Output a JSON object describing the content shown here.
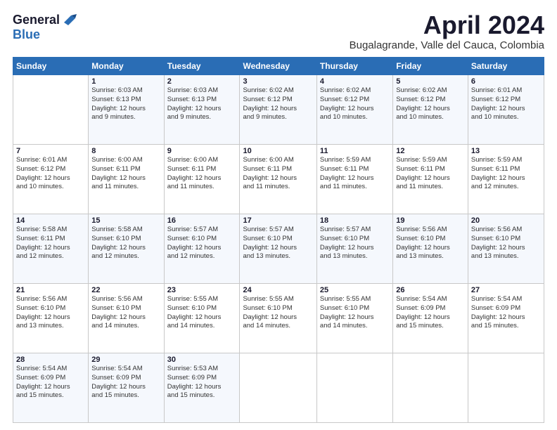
{
  "header": {
    "logo_line1": "General",
    "logo_line2": "Blue",
    "month_title": "April 2024",
    "location": "Bugalagrande, Valle del Cauca, Colombia"
  },
  "weekdays": [
    "Sunday",
    "Monday",
    "Tuesday",
    "Wednesday",
    "Thursday",
    "Friday",
    "Saturday"
  ],
  "weeks": [
    [
      {
        "day": "",
        "info": ""
      },
      {
        "day": "1",
        "info": "Sunrise: 6:03 AM\nSunset: 6:13 PM\nDaylight: 12 hours\nand 9 minutes."
      },
      {
        "day": "2",
        "info": "Sunrise: 6:03 AM\nSunset: 6:13 PM\nDaylight: 12 hours\nand 9 minutes."
      },
      {
        "day": "3",
        "info": "Sunrise: 6:02 AM\nSunset: 6:12 PM\nDaylight: 12 hours\nand 9 minutes."
      },
      {
        "day": "4",
        "info": "Sunrise: 6:02 AM\nSunset: 6:12 PM\nDaylight: 12 hours\nand 10 minutes."
      },
      {
        "day": "5",
        "info": "Sunrise: 6:02 AM\nSunset: 6:12 PM\nDaylight: 12 hours\nand 10 minutes."
      },
      {
        "day": "6",
        "info": "Sunrise: 6:01 AM\nSunset: 6:12 PM\nDaylight: 12 hours\nand 10 minutes."
      }
    ],
    [
      {
        "day": "7",
        "info": "Sunrise: 6:01 AM\nSunset: 6:12 PM\nDaylight: 12 hours\nand 10 minutes."
      },
      {
        "day": "8",
        "info": "Sunrise: 6:00 AM\nSunset: 6:11 PM\nDaylight: 12 hours\nand 11 minutes."
      },
      {
        "day": "9",
        "info": "Sunrise: 6:00 AM\nSunset: 6:11 PM\nDaylight: 12 hours\nand 11 minutes."
      },
      {
        "day": "10",
        "info": "Sunrise: 6:00 AM\nSunset: 6:11 PM\nDaylight: 12 hours\nand 11 minutes."
      },
      {
        "day": "11",
        "info": "Sunrise: 5:59 AM\nSunset: 6:11 PM\nDaylight: 12 hours\nand 11 minutes."
      },
      {
        "day": "12",
        "info": "Sunrise: 5:59 AM\nSunset: 6:11 PM\nDaylight: 12 hours\nand 11 minutes."
      },
      {
        "day": "13",
        "info": "Sunrise: 5:59 AM\nSunset: 6:11 PM\nDaylight: 12 hours\nand 12 minutes."
      }
    ],
    [
      {
        "day": "14",
        "info": "Sunrise: 5:58 AM\nSunset: 6:11 PM\nDaylight: 12 hours\nand 12 minutes."
      },
      {
        "day": "15",
        "info": "Sunrise: 5:58 AM\nSunset: 6:10 PM\nDaylight: 12 hours\nand 12 minutes."
      },
      {
        "day": "16",
        "info": "Sunrise: 5:57 AM\nSunset: 6:10 PM\nDaylight: 12 hours\nand 12 minutes."
      },
      {
        "day": "17",
        "info": "Sunrise: 5:57 AM\nSunset: 6:10 PM\nDaylight: 12 hours\nand 13 minutes."
      },
      {
        "day": "18",
        "info": "Sunrise: 5:57 AM\nSunset: 6:10 PM\nDaylight: 12 hours\nand 13 minutes."
      },
      {
        "day": "19",
        "info": "Sunrise: 5:56 AM\nSunset: 6:10 PM\nDaylight: 12 hours\nand 13 minutes."
      },
      {
        "day": "20",
        "info": "Sunrise: 5:56 AM\nSunset: 6:10 PM\nDaylight: 12 hours\nand 13 minutes."
      }
    ],
    [
      {
        "day": "21",
        "info": "Sunrise: 5:56 AM\nSunset: 6:10 PM\nDaylight: 12 hours\nand 13 minutes."
      },
      {
        "day": "22",
        "info": "Sunrise: 5:56 AM\nSunset: 6:10 PM\nDaylight: 12 hours\nand 14 minutes."
      },
      {
        "day": "23",
        "info": "Sunrise: 5:55 AM\nSunset: 6:10 PM\nDaylight: 12 hours\nand 14 minutes."
      },
      {
        "day": "24",
        "info": "Sunrise: 5:55 AM\nSunset: 6:10 PM\nDaylight: 12 hours\nand 14 minutes."
      },
      {
        "day": "25",
        "info": "Sunrise: 5:55 AM\nSunset: 6:10 PM\nDaylight: 12 hours\nand 14 minutes."
      },
      {
        "day": "26",
        "info": "Sunrise: 5:54 AM\nSunset: 6:09 PM\nDaylight: 12 hours\nand 15 minutes."
      },
      {
        "day": "27",
        "info": "Sunrise: 5:54 AM\nSunset: 6:09 PM\nDaylight: 12 hours\nand 15 minutes."
      }
    ],
    [
      {
        "day": "28",
        "info": "Sunrise: 5:54 AM\nSunset: 6:09 PM\nDaylight: 12 hours\nand 15 minutes."
      },
      {
        "day": "29",
        "info": "Sunrise: 5:54 AM\nSunset: 6:09 PM\nDaylight: 12 hours\nand 15 minutes."
      },
      {
        "day": "30",
        "info": "Sunrise: 5:53 AM\nSunset: 6:09 PM\nDaylight: 12 hours\nand 15 minutes."
      },
      {
        "day": "",
        "info": ""
      },
      {
        "day": "",
        "info": ""
      },
      {
        "day": "",
        "info": ""
      },
      {
        "day": "",
        "info": ""
      }
    ]
  ]
}
